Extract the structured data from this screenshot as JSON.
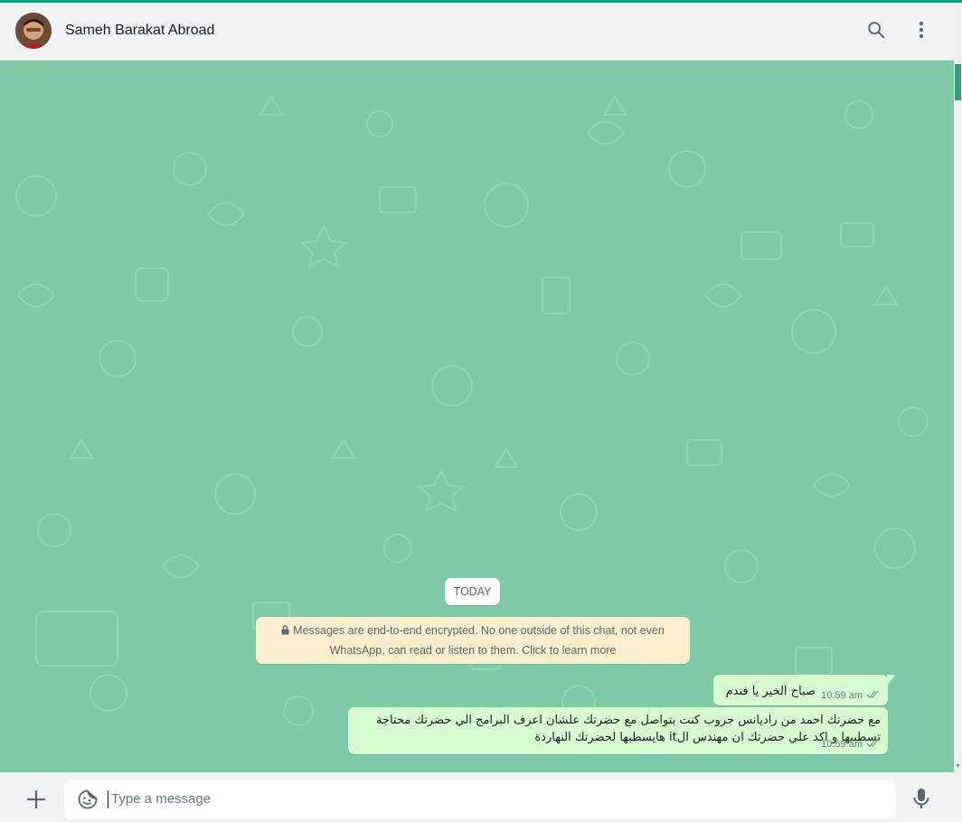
{
  "header": {
    "contact_name": "Sameh Barakat Abroad",
    "icons": [
      "search-icon",
      "menu-icon"
    ]
  },
  "chat": {
    "date_chip": "TODAY",
    "encryption_notice": {
      "line1": "Messages are end-to-end encrypted. No one outside of this chat, not even",
      "line2": "WhatsApp, can read or listen to them. Click to learn more",
      "icon": "lock-icon"
    },
    "messages": [
      {
        "direction": "outgoing",
        "text": "صباح الخير يا فندم",
        "time": "10:59 am",
        "status": "double-check-icon"
      },
      {
        "direction": "outgoing",
        "text_line1": "مع حضرتك احمد من راديانس جروب كنت بتواصل مع حضرتك علشان اعرف البرامج الي حضرتك محتاجة",
        "text_line2": "تسطبيها و اكد علي حضرتك ان مهندس الit  هايسطبها لحضرتك النهاردة",
        "time": "10:59 am",
        "status": "double-check-icon"
      }
    ]
  },
  "composer": {
    "placeholder": "Type a message",
    "icons": [
      "plus-icon",
      "sticker-icon",
      "mic-icon"
    ]
  },
  "colors": {
    "accent": "#00a884",
    "chat_background": "#7ecaa5",
    "outgoing_bubble": "#d9fdd3",
    "encryption_notice_bg": "#ffeecd"
  }
}
